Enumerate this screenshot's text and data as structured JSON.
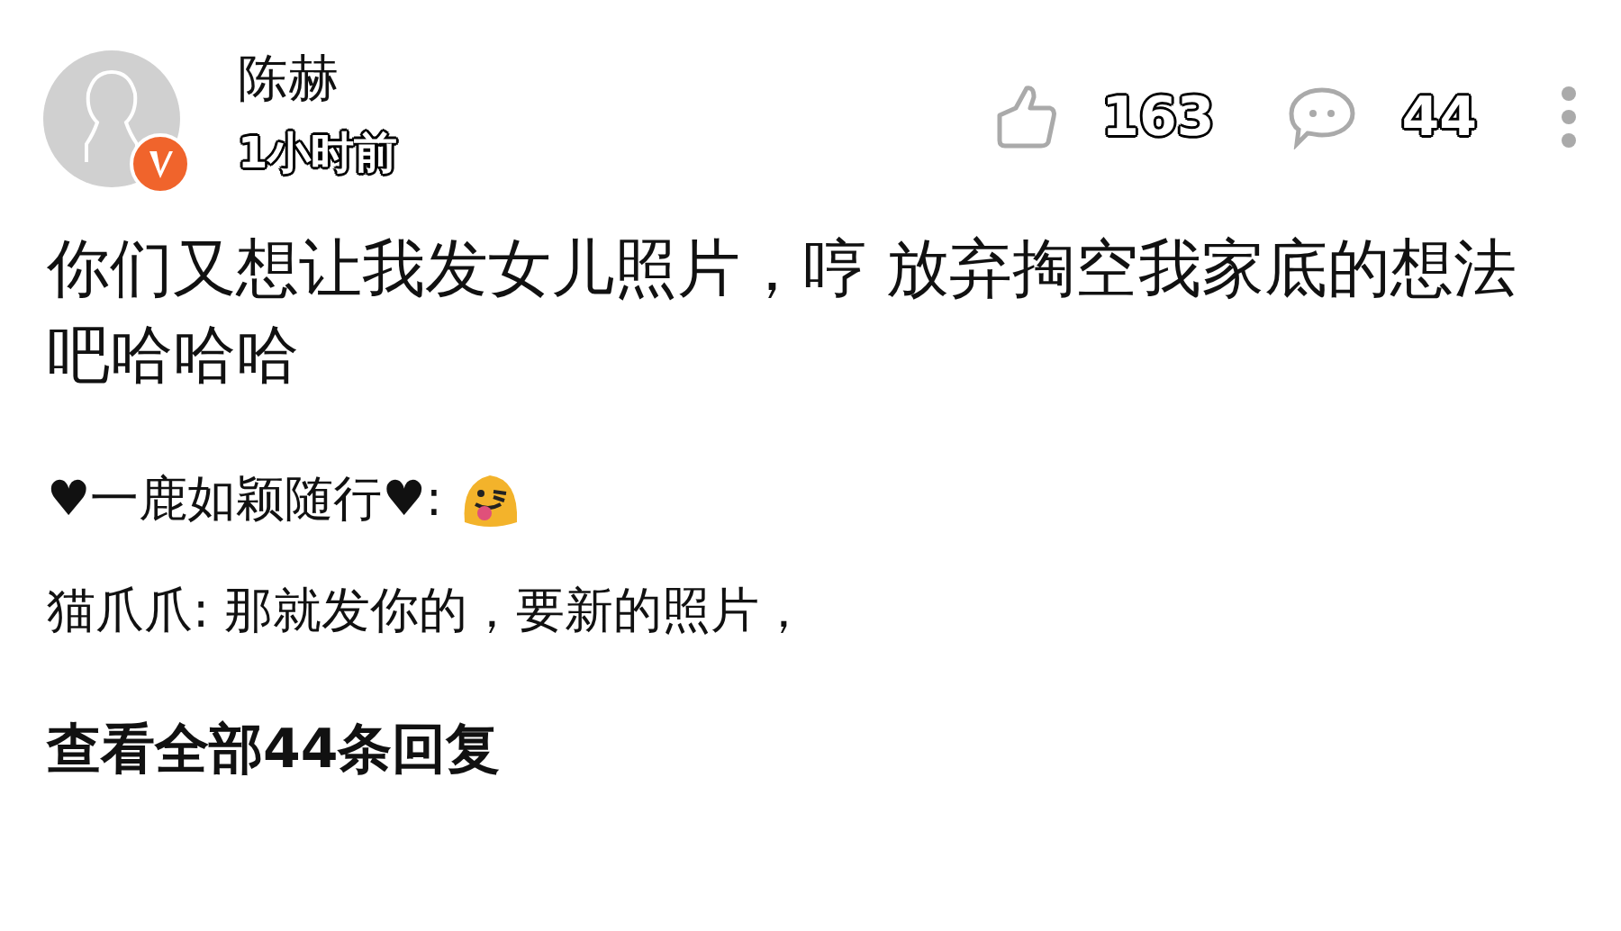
{
  "author": {
    "name": "陈赫",
    "time": "1小时前",
    "verified": true
  },
  "stats": {
    "likes": "163",
    "comments": "44"
  },
  "comment": "你们又想让我发女儿照片，哼 放弃掏空我家底的想法吧哈哈哈",
  "replies": [
    {
      "kind": "emoji",
      "user": "♥一鹿如颖随行♥:"
    },
    {
      "kind": "text",
      "user": "猫爪爪:",
      "text": "那就发你的，要新的照片，"
    }
  ],
  "more_replies": "查看全部44条回复"
}
